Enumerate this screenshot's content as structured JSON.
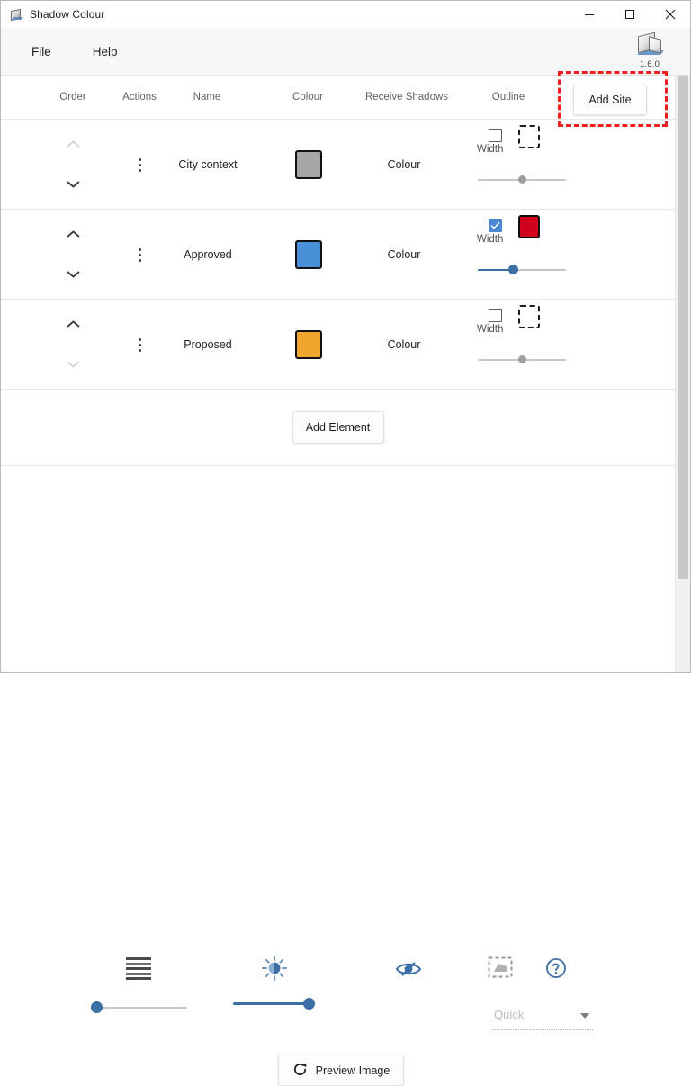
{
  "window": {
    "title": "Shadow Colour",
    "icon": "app-cube-icon",
    "controls": {
      "minimize": "minimize-icon",
      "maximize": "maximize-icon",
      "close": "close-icon"
    }
  },
  "menubar": {
    "items": [
      {
        "label": "File",
        "name": "menu-file"
      },
      {
        "label": "Help",
        "name": "menu-help"
      }
    ],
    "app_version": "1.6.0",
    "app_icon": "shadow-cube-icon"
  },
  "table": {
    "columns": [
      {
        "label": "Order",
        "name": "column-order"
      },
      {
        "label": "Actions",
        "name": "column-actions"
      },
      {
        "label": "Name",
        "name": "column-name"
      },
      {
        "label": "Colour",
        "name": "column-colour"
      },
      {
        "label": "Receive Shadows",
        "name": "column-receive-shadows"
      },
      {
        "label": "Outline",
        "name": "column-outline"
      }
    ],
    "add_site_label": "Add Site",
    "rows": [
      {
        "name": "City context",
        "colour_hex": "#a6a6a6",
        "receive_shadows_label": "Colour",
        "outline_enabled": false,
        "outline_colour_hex": null,
        "width_label": "Width",
        "width_percent": 50,
        "move_up_enabled": false,
        "move_down_enabled": true
      },
      {
        "name": "Approved",
        "colour_hex": "#4a90d9",
        "receive_shadows_label": "Colour",
        "outline_enabled": true,
        "outline_colour_hex": "#d0021b",
        "width_label": "Width",
        "width_percent": 40,
        "move_up_enabled": true,
        "move_down_enabled": true
      },
      {
        "name": "Proposed",
        "colour_hex": "#f0a62c",
        "receive_shadows_label": "Colour",
        "outline_enabled": false,
        "outline_colour_hex": null,
        "width_label": "Width",
        "width_percent": 50,
        "move_up_enabled": true,
        "move_down_enabled": false
      }
    ]
  },
  "add_element": {
    "label": "Add Element"
  },
  "tools": {
    "shadow_density": {
      "icon": "horizontal-lines-icon",
      "value_percent": 3
    },
    "sun_brightness": {
      "icon": "sun-icon",
      "value_percent": 94
    },
    "visibility": {
      "icon": "eye-off-icon"
    },
    "selection": {
      "icon": "selection-region-icon"
    },
    "help": {
      "icon": "help-circle-icon"
    },
    "quality_dropdown": {
      "placeholder": "Quick",
      "icon": "chevron-down-icon"
    }
  },
  "preview": {
    "label": "Preview Image",
    "icon": "refresh-icon"
  },
  "colors": {
    "accent_blue": "#3b6ea5",
    "checkbox_blue": "#4a86d4",
    "annotation_red": "#ef1f1f",
    "text_primary": "#1f1f1f",
    "text_muted": "#636363"
  }
}
